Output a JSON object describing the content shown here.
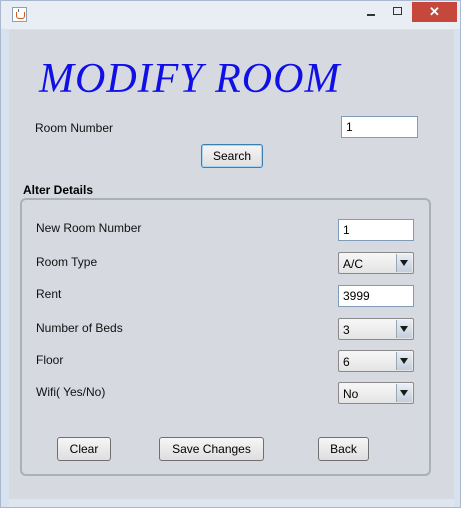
{
  "window": {
    "title": "",
    "close_glyph": "✕"
  },
  "heading": "MODIFY ROOM",
  "search": {
    "room_number_label": "Room Number",
    "room_number_value": "1",
    "search_button": "Search"
  },
  "details": {
    "group_title": "Alter Details",
    "new_room_number_label": "New Room Number",
    "new_room_number_value": "1",
    "room_type_label": "Room Type",
    "room_type_value": "A/C",
    "rent_label": "Rent",
    "rent_value": "3999",
    "beds_label": "Number of Beds",
    "beds_value": "3",
    "floor_label": "Floor",
    "floor_value": "6",
    "wifi_label": "Wifi( Yes/No)",
    "wifi_value": "No"
  },
  "actions": {
    "clear": "Clear",
    "save": "Save Changes",
    "back": "Back"
  },
  "icons": {
    "app": "java-cup-icon",
    "minimize": "minimize-icon",
    "maximize": "maximize-icon",
    "close": "close-icon",
    "dropdown": "chevron-down-icon"
  },
  "colors": {
    "heading": "#1010e6",
    "close_button": "#c6473b"
  }
}
